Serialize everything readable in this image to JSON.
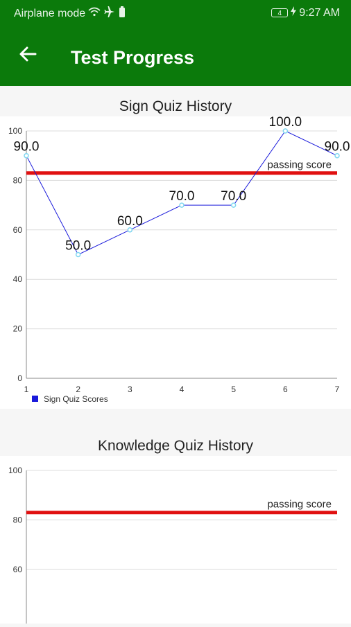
{
  "status_bar": {
    "left_text": "Airplane mode",
    "battery_level": "4",
    "time": "9:27 AM",
    "icons": [
      "wifi-icon",
      "airplane-icon",
      "battery-icon",
      "charging-bolt-icon"
    ]
  },
  "app_bar": {
    "title": "Test Progress",
    "back_icon": "arrow-left-icon",
    "color": "#0b7a0b"
  },
  "charts": {
    "sign": {
      "title": "Sign Quiz History",
      "passing_label": "passing score"
    },
    "knowledge": {
      "title": "Knowledge Quiz History",
      "passing_label": "passing score"
    }
  },
  "chart_data": [
    {
      "type": "line",
      "title": "Sign Quiz History",
      "x": [
        1,
        2,
        3,
        4,
        5,
        6,
        7
      ],
      "series": [
        {
          "name": "Sign Quiz Scores",
          "color": "#1a1adb",
          "values": [
            90.0,
            50.0,
            60.0,
            70.0,
            70.0,
            100.0,
            90.0
          ]
        }
      ],
      "point_labels": [
        "90.0",
        "50.0",
        "60.0",
        "70.0",
        "70.0",
        "100.0",
        "90.0"
      ],
      "ylim": [
        0,
        100
      ],
      "yticks": [
        0,
        20,
        40,
        60,
        80,
        100
      ],
      "xticks": [
        1,
        2,
        3,
        4,
        5,
        6,
        7
      ],
      "limit_line": {
        "value": 83,
        "label": "passing score",
        "color": "#e01010"
      },
      "grid": "horizontal",
      "legend": "bottom-left"
    },
    {
      "type": "line",
      "title": "Knowledge Quiz History",
      "x": [],
      "series": [],
      "ylim": [
        0,
        100
      ],
      "yticks": [
        60,
        80,
        100
      ],
      "limit_line": {
        "value": 83,
        "label": "passing score",
        "color": "#e01010"
      },
      "grid": "horizontal"
    }
  ]
}
